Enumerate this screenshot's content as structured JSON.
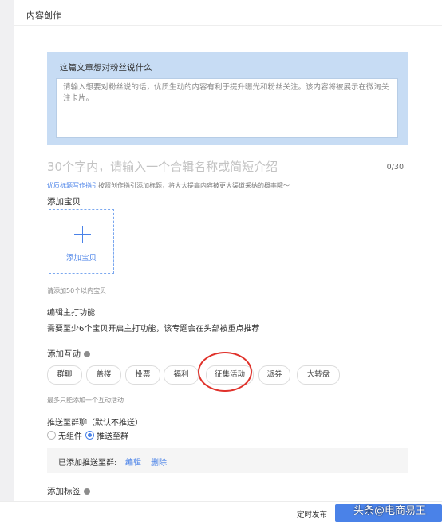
{
  "page": {
    "title": "内容创作"
  },
  "message": {
    "label": "这篇文章想对粉丝说什么",
    "placeholder": "请输入想要对粉丝说的话，优质生动的内容有利于提升曝光和粉丝关注。该内容将被展示在微淘关注卡片。"
  },
  "headline": {
    "placeholder": "30个字内，请输入一个合辑名称或简短介绍",
    "counter": "0/30"
  },
  "guide": {
    "link": "优质标题写作指引",
    "text": "按照创作指引添加标题，将大大提高内容被更大渠道采纳的概率哦～"
  },
  "product": {
    "section_label": "添加宝贝",
    "add_label": "添加宝贝",
    "hint": "请添加50个以内宝贝"
  },
  "feature": {
    "title": "编辑主打功能",
    "description": "需要至少6个宝贝开启主打功能，该专题会在头部被重点推荐"
  },
  "interaction": {
    "label": "添加互动",
    "chips": [
      "群聊",
      "盖楼",
      "投票",
      "福利",
      "征集活动",
      "派券",
      "大转盘"
    ],
    "highlighted": "征集活动",
    "hint": "最多只能添加一个互动活动"
  },
  "push": {
    "label": "推送至群聊（默认不推送）",
    "options": [
      "无组件",
      "推送至群"
    ],
    "selected": "推送至群",
    "status": "已添加推送至群:",
    "edit": "编辑",
    "delete": "删除"
  },
  "tags": {
    "label": "添加标签"
  },
  "footer": {
    "schedule": "定时发布",
    "watermark": "头条@电商易王"
  },
  "colors": {
    "accent": "#4a82e8",
    "message_bg": "#c7dcf4",
    "highlight": "#e0322b"
  }
}
